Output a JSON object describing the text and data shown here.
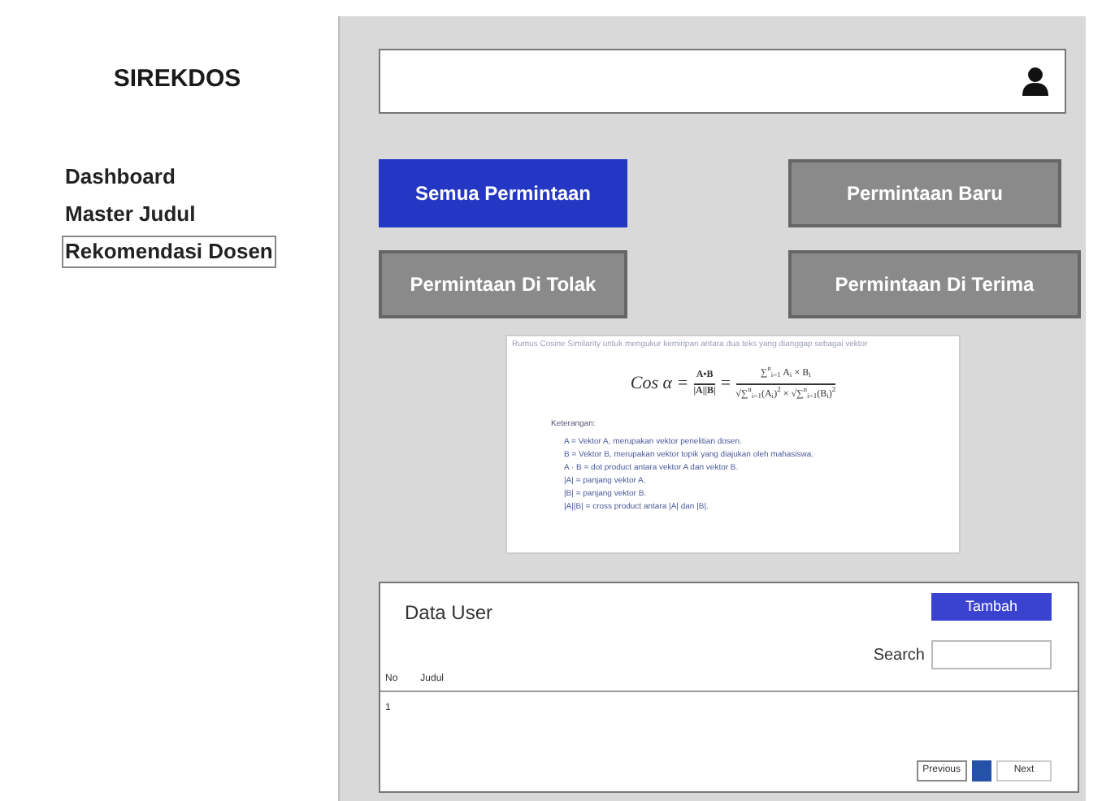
{
  "sidebar": {
    "title": "SIREKDOS",
    "items": [
      {
        "label": "Dashboard",
        "selected": false
      },
      {
        "label": "Master Judul",
        "selected": false
      },
      {
        "label": "Rekomendasi Dosen",
        "selected": true
      }
    ]
  },
  "filters": [
    {
      "label": "Semua Permintaan",
      "selected": true
    },
    {
      "label": "Permintaan Baru",
      "selected": false
    },
    {
      "label": "Permintaan Di Tolak",
      "selected": false
    },
    {
      "label": "Permintaan Di Terima",
      "selected": false
    }
  ],
  "formula_image": {
    "caption": "Rumus Cosine Similarity untuk mengukur kemiripan antara dua teks yang dianggap sebagai vektor",
    "lhs": "Cos α =",
    "fraction_1": {
      "numerator": "A•B",
      "denominator": "|A||B|"
    },
    "equals": "=",
    "fraction_2": {
      "numerator": "∑$^{n}$$_{i=1}$ A$_{i}$ × B$_{i}$",
      "denominator": "√∑$^{n}$$_{i=1}$(A$_{i}$)$^{2}$ × √∑$^{n}$$_{i=1}$(B$_{i}$)$^{2}$"
    },
    "legend_title": "Keterangan:",
    "legend": [
      "A = Vektor A, merupakan vektor penelitian dosen.",
      "B = Vektor B, merupakan vektor topik yang diajukan oleh mahasiswa.",
      "A · B = dot product antara vektor A dan vektor B.",
      "|A| = panjang vektor A.",
      "|B| = panjang vektor B.",
      "|A||B| = cross product antara |A| dan |B|."
    ]
  },
  "data_panel": {
    "title": "Data User",
    "add_button": "Tambah",
    "search_label": "Search",
    "columns": [
      "No",
      "Judul"
    ],
    "rows": [
      [
        "1"
      ]
    ],
    "pagination": {
      "previous": "Previous",
      "next": "Next"
    }
  }
}
